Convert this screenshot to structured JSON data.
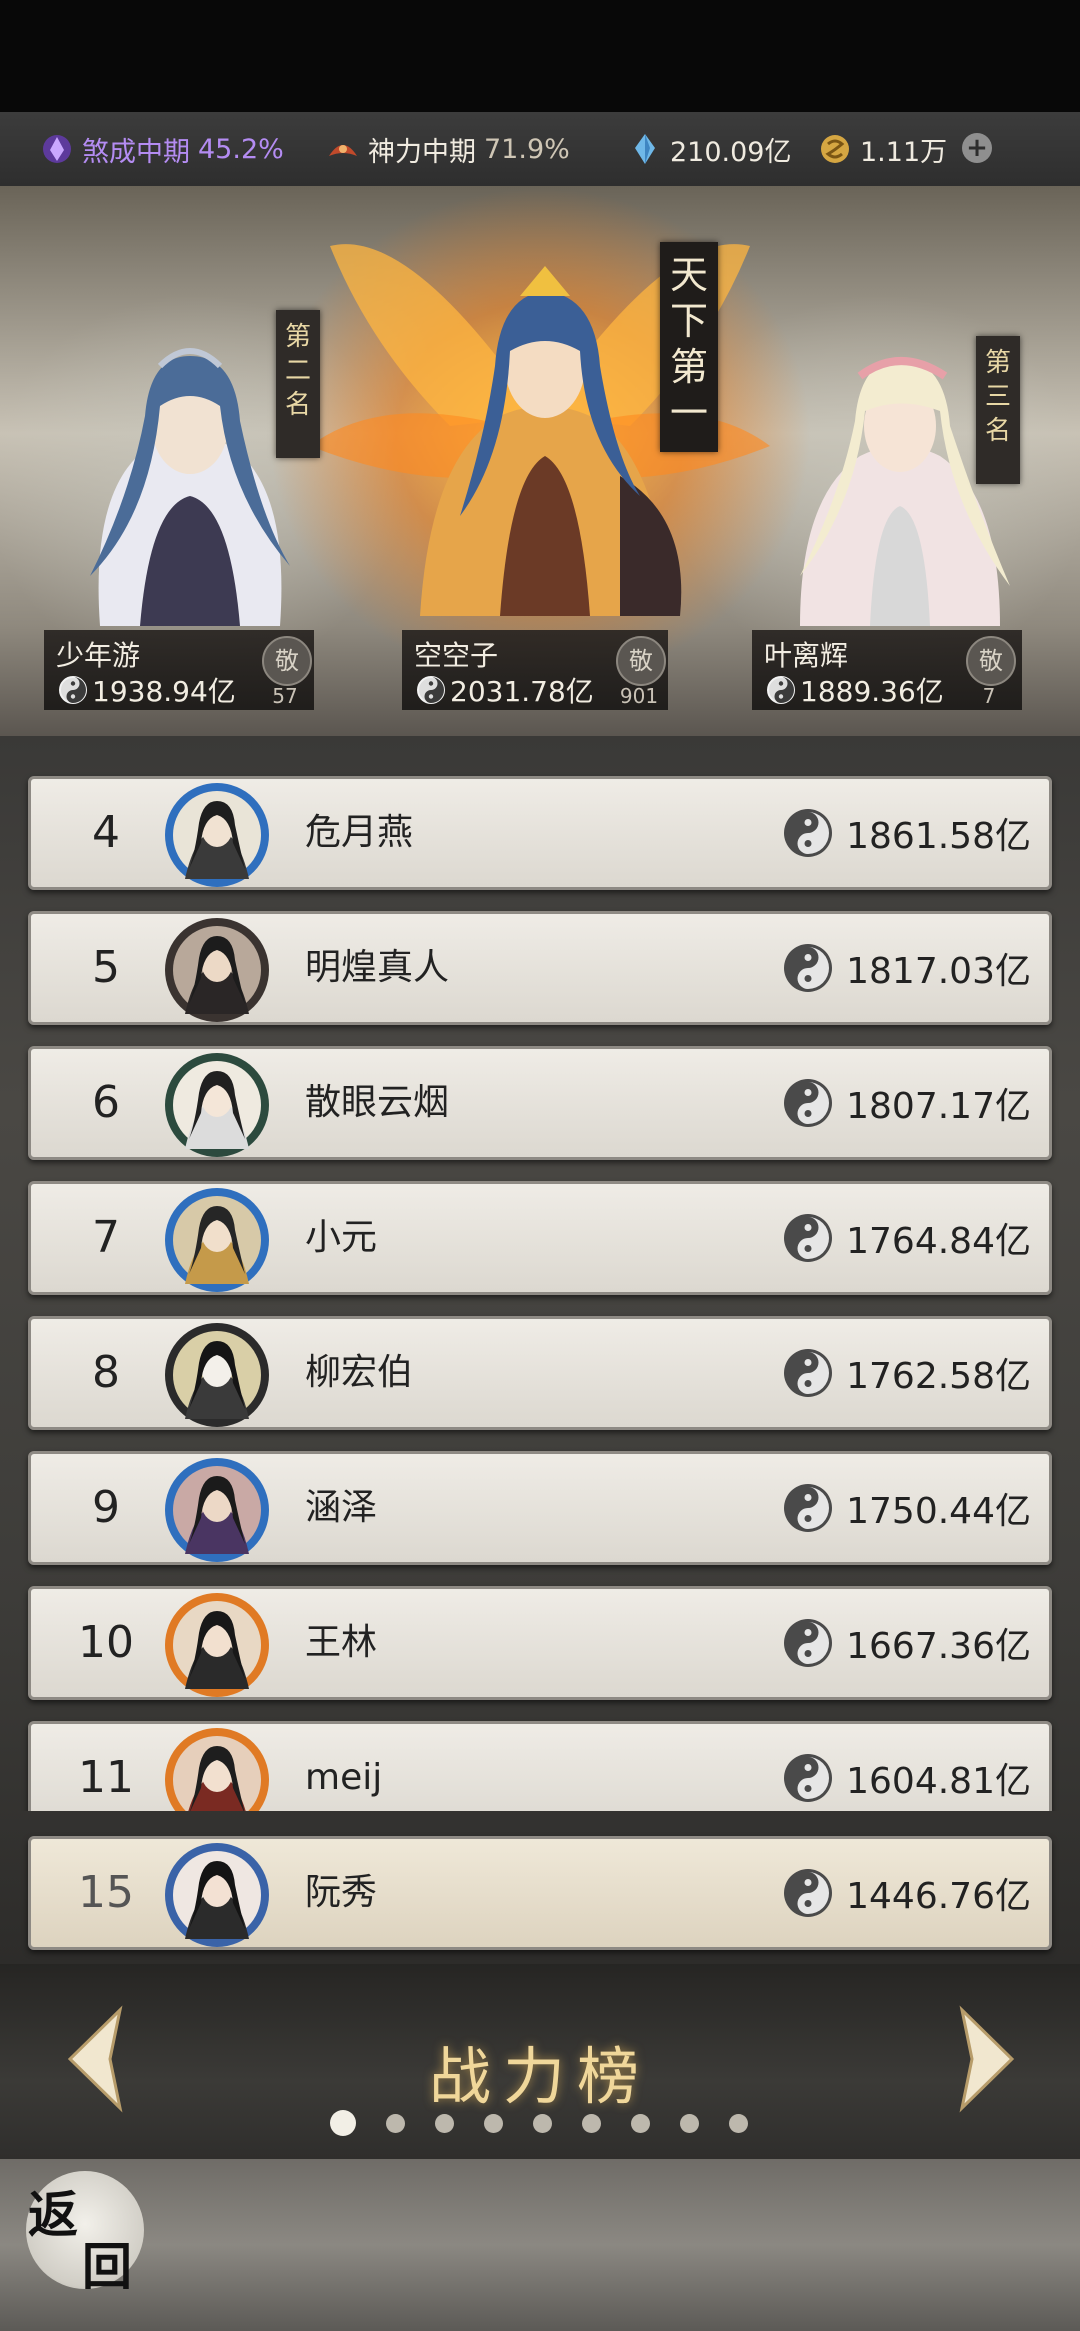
{
  "status_bar": {
    "realm1": {
      "label": "煞成中期",
      "percent": "45.2%"
    },
    "realm2": {
      "label": "神力中期",
      "percent": "71.9%"
    },
    "crystal": "210.09亿",
    "coin": "1.11万"
  },
  "podium": {
    "first": {
      "badge": [
        "天",
        "下",
        "第",
        "一"
      ],
      "name": "空空子",
      "power": "2031.78亿",
      "respect_label": "敬",
      "respect_count": "901"
    },
    "second": {
      "badge": [
        "第",
        "二",
        "名"
      ],
      "name": "少年游",
      "power": "1938.94亿",
      "respect_label": "敬",
      "respect_count": "57"
    },
    "third": {
      "badge": [
        "第",
        "三",
        "名"
      ],
      "name": "叶离辉",
      "power": "1889.36亿",
      "respect_label": "敬",
      "respect_count": "7"
    }
  },
  "rankings": [
    {
      "rank": "4",
      "name": "危月燕",
      "power": "1861.58亿"
    },
    {
      "rank": "5",
      "name": "明煌真人",
      "power": "1817.03亿"
    },
    {
      "rank": "6",
      "name": "散眼云烟",
      "power": "1807.17亿"
    },
    {
      "rank": "7",
      "name": "小元",
      "power": "1764.84亿"
    },
    {
      "rank": "8",
      "name": "柳宏伯",
      "power": "1762.58亿"
    },
    {
      "rank": "9",
      "name": "涵泽",
      "power": "1750.44亿"
    },
    {
      "rank": "10",
      "name": "王林",
      "power": "1667.36亿"
    },
    {
      "rank": "11",
      "name": "meij",
      "power": "1604.81亿"
    }
  ],
  "self_row": {
    "rank": "15",
    "name": "阮秀",
    "power": "1446.76亿"
  },
  "footer": {
    "title": "战力榜",
    "page_count": 9,
    "active_page": 1
  },
  "back_button": {
    "line1": "返",
    "line2": "回"
  },
  "icons": {
    "realm1": "purple-aura-icon",
    "realm2": "red-aura-icon",
    "crystal": "blue-crystal-icon",
    "coin": "gold-coin-icon",
    "power": "yin-yang-icon"
  },
  "colors": {
    "gold_text": "#f0d79a",
    "row_bg": "#ebe8e2",
    "self_row_bg": "#e6ddc9",
    "realm1": "#b48cf2"
  }
}
